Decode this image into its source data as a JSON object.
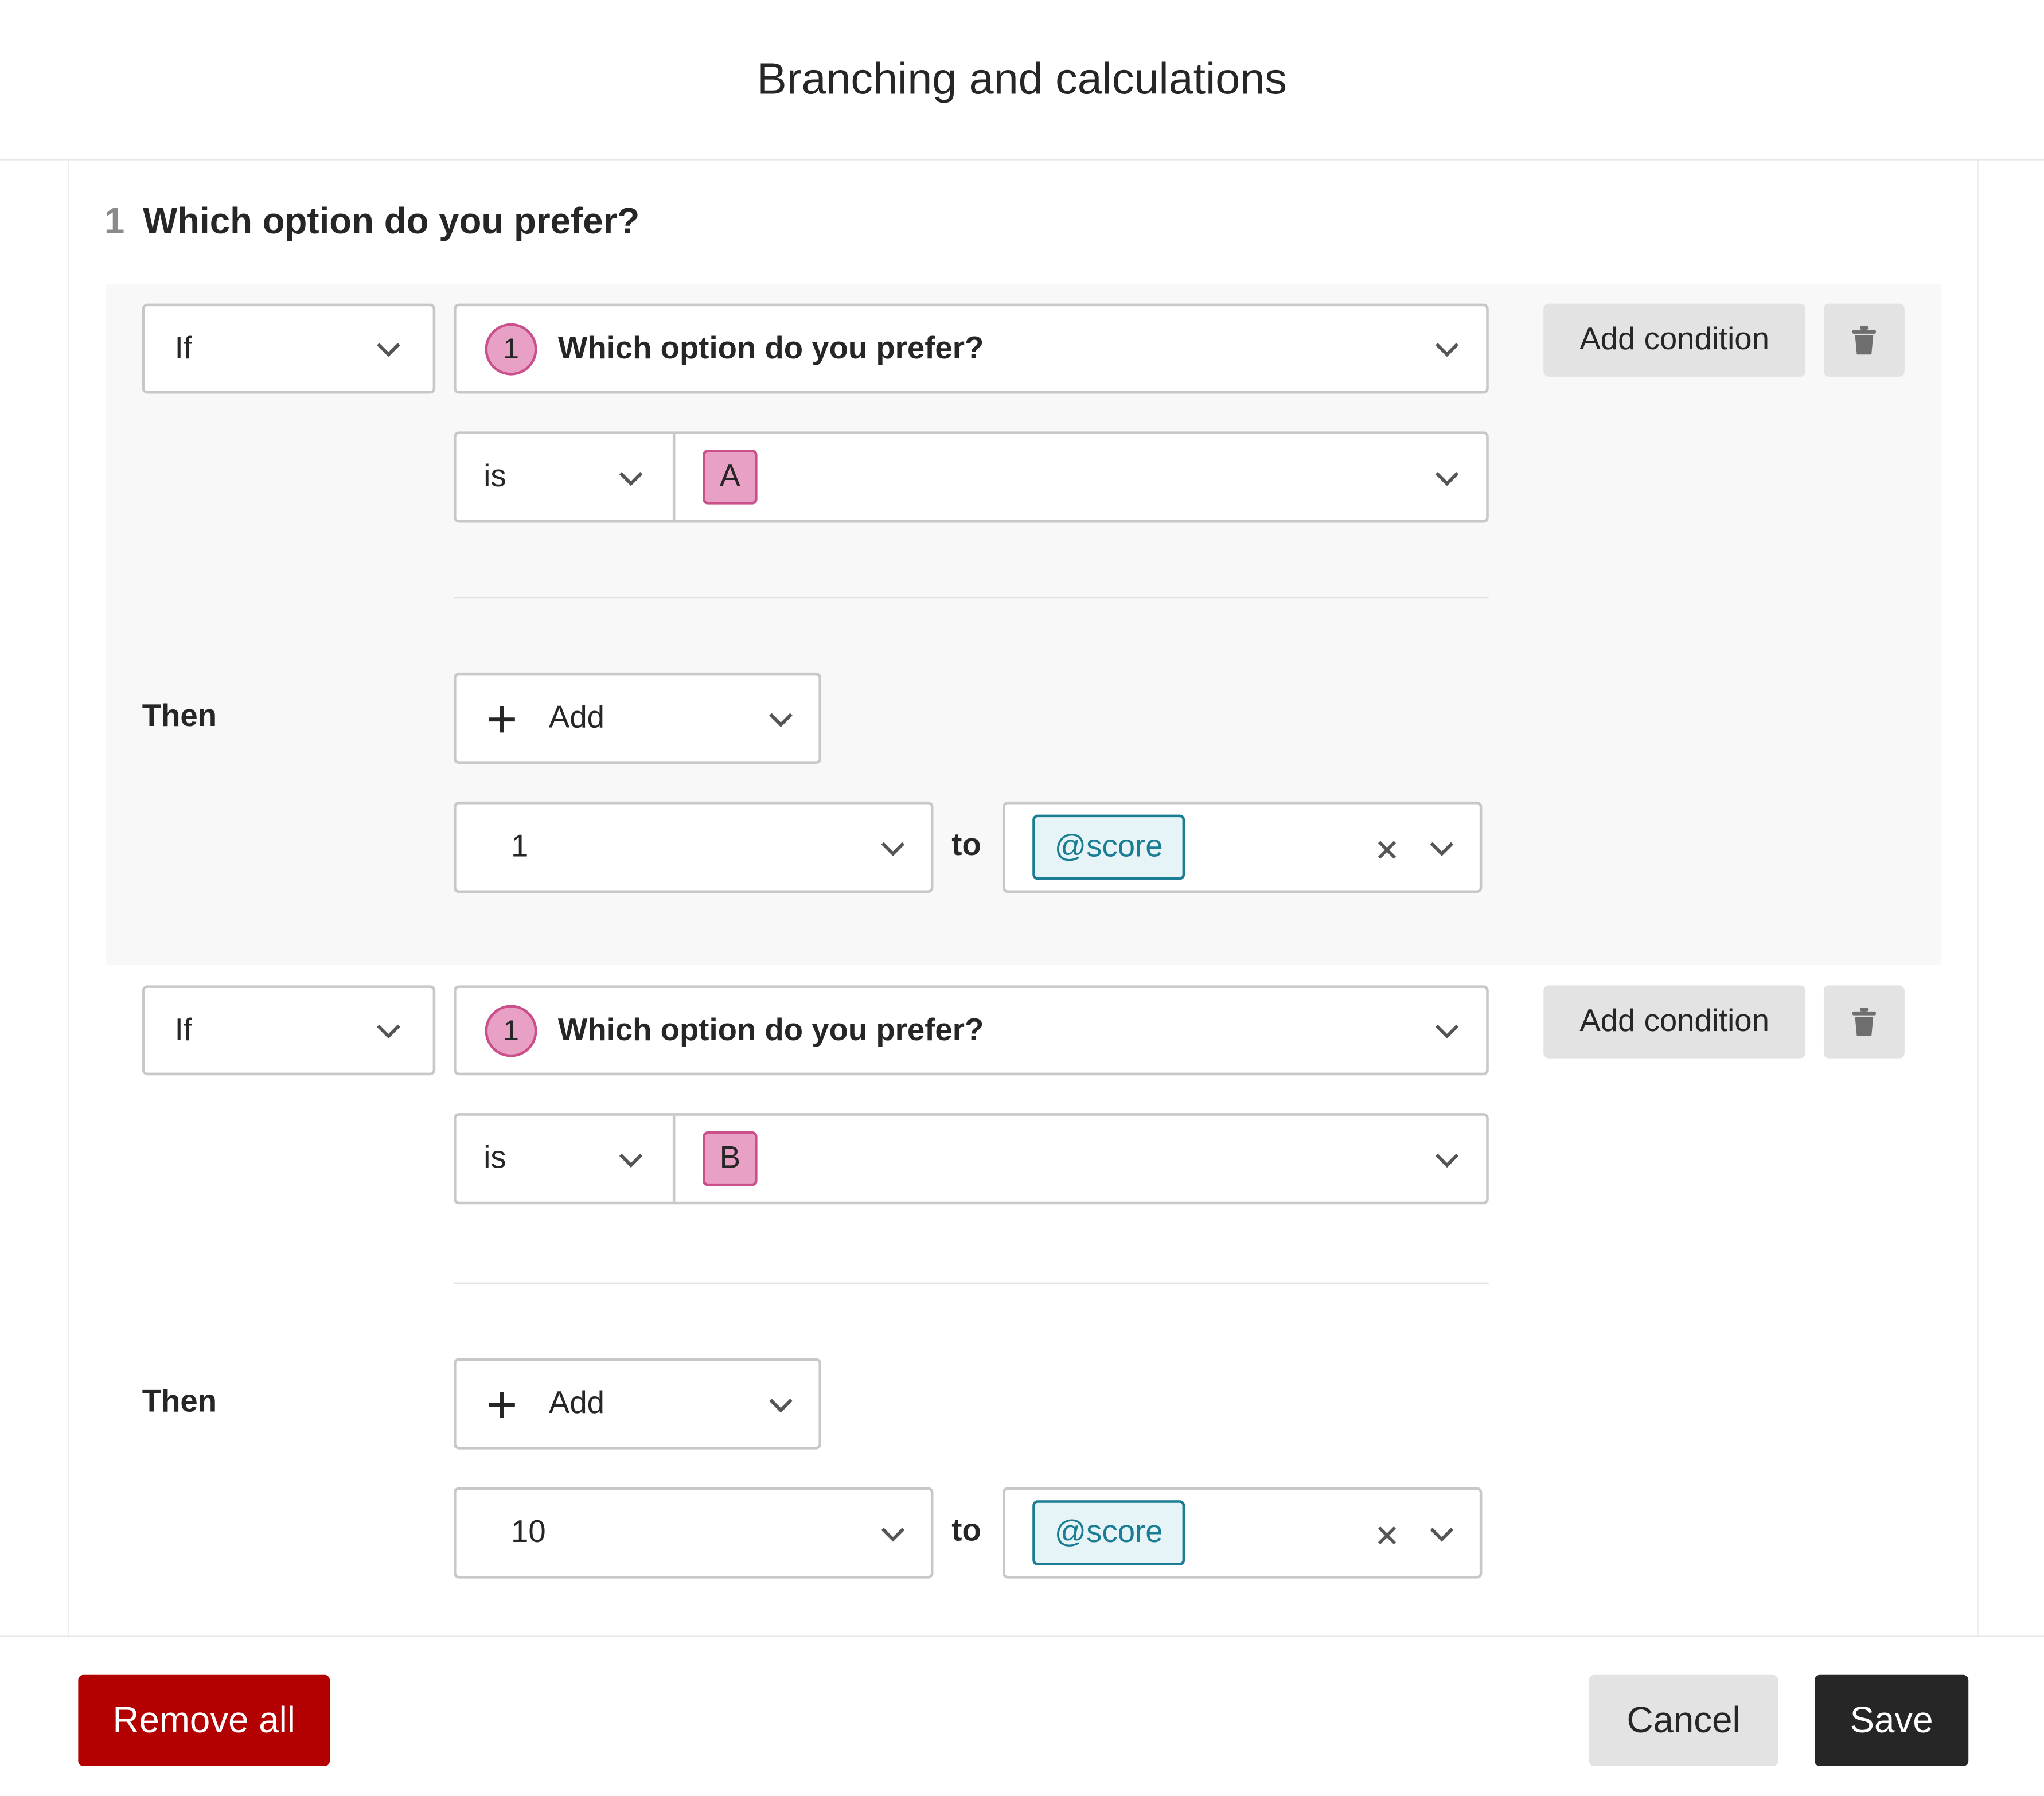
{
  "modal": {
    "title": "Branching and calculations"
  },
  "question": {
    "number": "1",
    "title": "Which option do you prefer?"
  },
  "rules": [
    {
      "if_label": "If",
      "question_badge": "1",
      "question_text": "Which option do you prefer?",
      "operator": "is",
      "answer": "A",
      "add_condition_label": "Add condition",
      "then_label": "Then",
      "add_label": "Add",
      "action_value": "1",
      "to_label": "to",
      "variable": "@score"
    },
    {
      "if_label": "If",
      "question_badge": "1",
      "question_text": "Which option do you prefer?",
      "operator": "is",
      "answer": "B",
      "add_condition_label": "Add condition",
      "then_label": "Then",
      "add_label": "Add",
      "action_value": "10",
      "to_label": "to",
      "variable": "@score"
    }
  ],
  "footer": {
    "remove_all_label": "Remove all",
    "cancel_label": "Cancel",
    "save_label": "Save"
  },
  "colors": {
    "danger": "#b30000",
    "primary_dark": "#262627",
    "answer_badge": "#e8a0c4",
    "variable_tag": "#1a7d93"
  }
}
